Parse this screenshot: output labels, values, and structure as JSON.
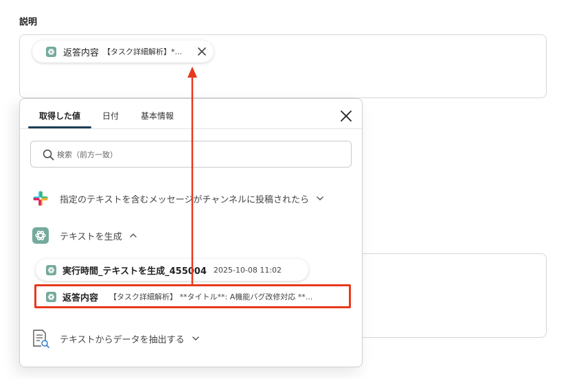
{
  "field": {
    "label": "説明"
  },
  "chip": {
    "name": "返答内容",
    "value": "【タスク詳細解析】*..."
  },
  "popup": {
    "tabs": [
      {
        "label": "取得した値"
      },
      {
        "label": "日付"
      },
      {
        "label": "基本情報"
      }
    ],
    "search": {
      "placeholder": "検索（前方一致）",
      "value": ""
    },
    "groups": [
      {
        "label": "指定のテキストを含むメッセージがチャンネルに投稿されたら",
        "icon": "slack-icon",
        "state": "collapsed"
      },
      {
        "label": "テキストを生成",
        "icon": "chatgpt-icon",
        "state": "expanded"
      },
      {
        "label": "テキストからデータを抽出する",
        "icon": "document-search-icon",
        "state": "collapsed"
      }
    ],
    "items": [
      {
        "name": "実行時間_テキストを生成_455004",
        "value": "2025-10-08 11:02"
      },
      {
        "name": "返答内容",
        "value": "【タスク詳細解析】 **タイトル**: A機能バグ改修対応 **..."
      }
    ]
  },
  "colors": {
    "accent": "#1e3d54",
    "highlight": "#e8381c",
    "chatgpt_green": "#74aa9c"
  }
}
